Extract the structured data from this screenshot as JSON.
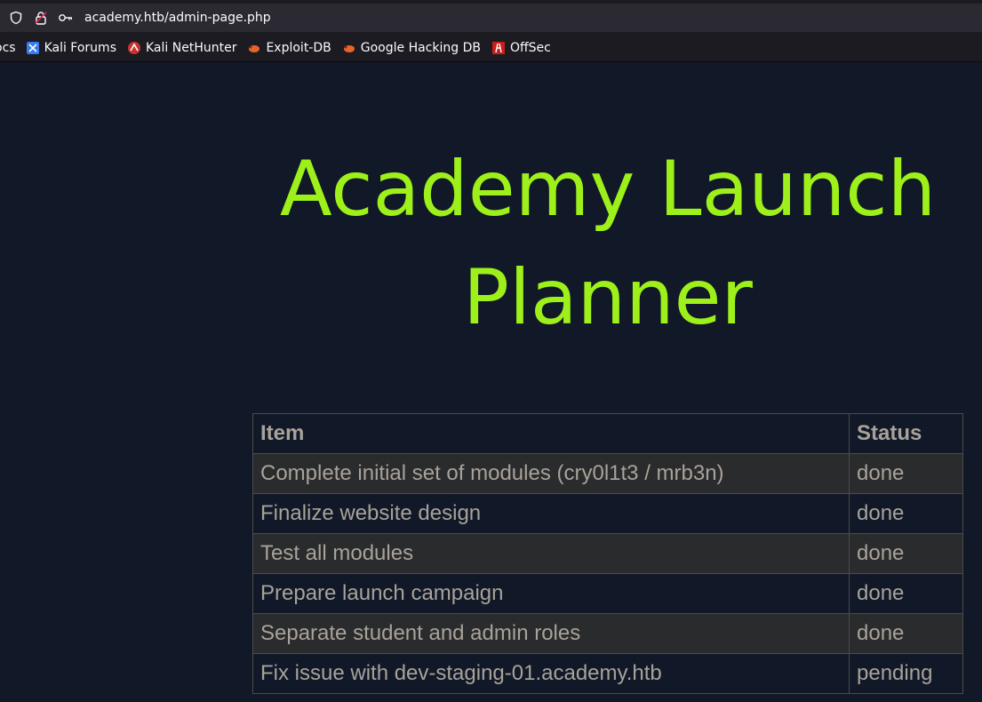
{
  "browser": {
    "url": "academy.htb/admin-page.php",
    "bookmarks": [
      {
        "label": "ocs",
        "icon": "docs-icon"
      },
      {
        "label": "Kali Forums",
        "icon": "kali-forums-icon"
      },
      {
        "label": "Kali NetHunter",
        "icon": "kali-nethunter-icon"
      },
      {
        "label": "Exploit-DB",
        "icon": "exploit-db-icon"
      },
      {
        "label": "Google Hacking DB",
        "icon": "google-hacking-db-icon"
      },
      {
        "label": "OffSec",
        "icon": "offsec-icon"
      }
    ]
  },
  "page": {
    "title": "Academy Launch Planner",
    "table": {
      "headers": [
        "Item",
        "Status"
      ],
      "rows": [
        {
          "item": "Complete initial set of modules (cry0l1t3 / mrb3n)",
          "status": "done"
        },
        {
          "item": "Finalize website design",
          "status": "done"
        },
        {
          "item": "Test all modules",
          "status": "done"
        },
        {
          "item": "Prepare launch campaign",
          "status": "done"
        },
        {
          "item": "Separate student and admin roles",
          "status": "done"
        },
        {
          "item": "Fix issue with dev-staging-01.academy.htb",
          "status": "pending"
        }
      ]
    }
  },
  "colors": {
    "page_bg": "#111827",
    "title": "#9ef01a",
    "table_text": "#a8a29a",
    "odd_row_bg": "#2a2b2c"
  }
}
